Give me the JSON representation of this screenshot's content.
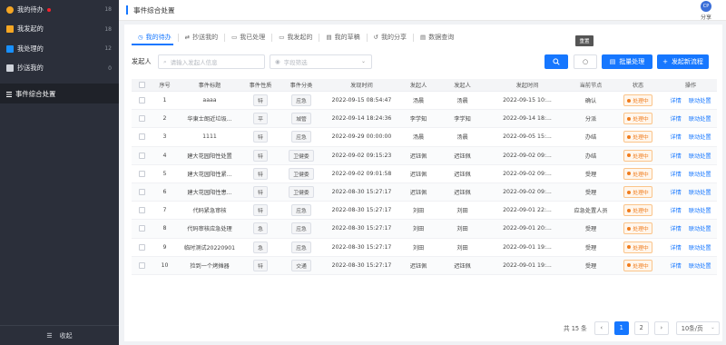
{
  "sidebar": {
    "items": [
      {
        "label": "我的待办",
        "count": "18",
        "icon": "todo-icon",
        "color": "#f5a623",
        "dot": true
      },
      {
        "label": "我发起的",
        "count": "18",
        "icon": "send-icon",
        "color": "#f5a623",
        "dot": false
      },
      {
        "label": "我处理的",
        "count": "12",
        "icon": "process-icon",
        "color": "#1890ff",
        "dot": false
      },
      {
        "label": "抄送我的",
        "count": "0",
        "icon": "cc-icon",
        "color": "#cfd3da",
        "dot": false
      }
    ],
    "main_item": "事件综合处置",
    "collapse_label": "收起"
  },
  "header": {
    "title": "事件综合处置",
    "share_label": "分享",
    "avatar_text": "CP"
  },
  "tabs": [
    {
      "label": "我的待办",
      "icon": "clock-icon",
      "active": true
    },
    {
      "label": "抄送我的",
      "icon": "cc-icon",
      "active": false
    },
    {
      "label": "我已处理",
      "icon": "done-icon",
      "active": false
    },
    {
      "label": "我发起的",
      "icon": "initiated-icon",
      "active": false
    },
    {
      "label": "我的草稿",
      "icon": "draft-icon",
      "active": false
    },
    {
      "label": "我的分享",
      "icon": "share-icon",
      "active": false
    },
    {
      "label": "数据查询",
      "icon": "data-icon",
      "active": false
    }
  ],
  "tooltip": "重置",
  "filter": {
    "initiator_label": "发起人",
    "initiator_placeholder": "请输入发起人信息",
    "field_placeholder": "字段筛选",
    "batch_label": "批量处理",
    "new_label": "发起新流程"
  },
  "table": {
    "headers": {
      "no": "序号",
      "title": "事件标题",
      "nature": "事件性质",
      "category": "事件分类",
      "time": "发现时间",
      "initiator": "发起人",
      "owner": "发起人",
      "start": "发起时间",
      "node": "当前节点",
      "status": "状态",
      "actions": "操作"
    },
    "rows": [
      {
        "no": "1",
        "title": "aaaa",
        "nature": "特",
        "category": "应急",
        "time": "2022-09-15 08:54:47",
        "initiator": "汤晨",
        "owner": "汤晨",
        "start": "2022-09-15 10:...",
        "node": "确认",
        "status": "处理中",
        "detail": "详情",
        "link": "联动处置"
      },
      {
        "no": "2",
        "title": "华東士朗近垃圾...",
        "nature": "平",
        "category": "城管",
        "time": "2022-09-14 18:24:36",
        "initiator": "李学知",
        "owner": "李学知",
        "start": "2022-09-14 18:...",
        "node": "分派",
        "status": "处理中",
        "detail": "详情",
        "link": "联动处置"
      },
      {
        "no": "3",
        "title": "1111",
        "nature": "特",
        "category": "应急",
        "time": "2022-09-29 00:00:00",
        "initiator": "汤晨",
        "owner": "汤晨",
        "start": "2022-09-05 15:...",
        "node": "办结",
        "status": "处理中",
        "detail": "详情",
        "link": "联动处置"
      },
      {
        "no": "4",
        "title": "建大花园阳性处置",
        "nature": "特",
        "category": "卫健委",
        "time": "2022-09-02 09:15:23",
        "initiator": "迟钰佩",
        "owner": "迟钰佩",
        "start": "2022-09-02 09:...",
        "node": "办结",
        "status": "处理中",
        "detail": "详情",
        "link": "联动处置"
      },
      {
        "no": "5",
        "title": "建大花园阳性紧...",
        "nature": "特",
        "category": "卫健委",
        "time": "2022-09-02 09:01:58",
        "initiator": "迟钰佩",
        "owner": "迟钰佩",
        "start": "2022-09-02 09:...",
        "node": "受理",
        "status": "处理中",
        "detail": "详情",
        "link": "联动处置"
      },
      {
        "no": "6",
        "title": "建大花园阳性患...",
        "nature": "特",
        "category": "卫健委",
        "time": "2022-08-30 15:27:17",
        "initiator": "迟钰佩",
        "owner": "迟钰佩",
        "start": "2022-09-02 09:...",
        "node": "受理",
        "status": "处理中",
        "detail": "详情",
        "link": "联动处置"
      },
      {
        "no": "7",
        "title": "代码紧急审核",
        "nature": "特",
        "category": "应急",
        "time": "2022-08-30 15:27:17",
        "initiator": "刘田",
        "owner": "刘田",
        "start": "2022-09-01 22:...",
        "node": "应急处置人员",
        "status": "处理中",
        "detail": "详情",
        "link": "联动处置"
      },
      {
        "no": "8",
        "title": "代码审核应急处理",
        "nature": "急",
        "category": "应急",
        "time": "2022-08-30 15:27:17",
        "initiator": "刘田",
        "owner": "刘田",
        "start": "2022-09-01 20:...",
        "node": "受理",
        "status": "处理中",
        "detail": "详情",
        "link": "联动处置"
      },
      {
        "no": "9",
        "title": "临时测试20220901",
        "nature": "急",
        "category": "应急",
        "time": "2022-08-30 15:27:17",
        "initiator": "刘田",
        "owner": "刘田",
        "start": "2022-09-01 19:...",
        "node": "受理",
        "status": "处理中",
        "detail": "详情",
        "link": "联动处置"
      },
      {
        "no": "10",
        "title": "捡到一个烤摊器",
        "nature": "特",
        "category": "交通",
        "time": "2022-08-30 15:27:17",
        "initiator": "迟钰佩",
        "owner": "迟钰佩",
        "start": "2022-09-01 19:...",
        "node": "受理",
        "status": "处理中",
        "detail": "详情",
        "link": "联动处置"
      }
    ]
  },
  "pagination": {
    "total": "共 15 条",
    "pages": [
      "1",
      "2"
    ],
    "current": "1",
    "page_size": "10条/页"
  },
  "colors": {
    "accent": "#1677ff",
    "sidebar_bg": "#2b2f3a",
    "status": "#f07c1c"
  }
}
